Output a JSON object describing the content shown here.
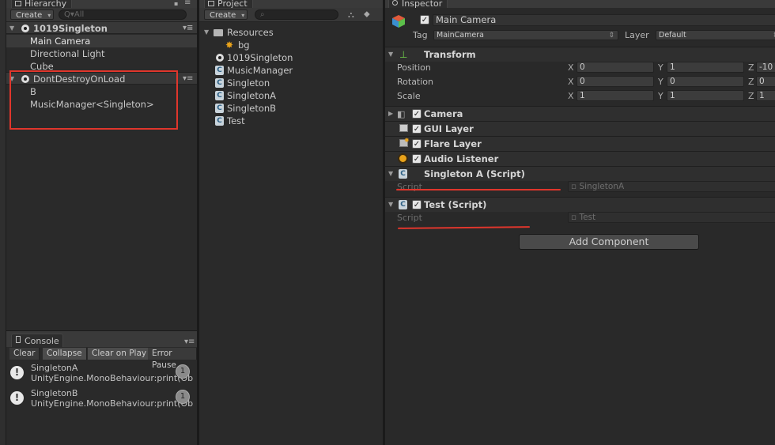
{
  "hierarchy": {
    "tab_label": "Hierarchy",
    "create_label": "Create",
    "search_placeholder": "Q▾All",
    "scenes": [
      {
        "name": "1019Singleton",
        "items": [
          "Main Camera",
          "Directional Light",
          "Cube"
        ]
      },
      {
        "name": "DontDestroyOnLoad",
        "items": [
          "B",
          "MusicManager<Singleton>"
        ]
      }
    ]
  },
  "project": {
    "tab_label": "Project",
    "create_label": "Create",
    "items": [
      {
        "name": "Resources",
        "icon": "folder-icon"
      },
      {
        "name": "bg",
        "icon": "image-icon"
      },
      {
        "name": "1019Singleton",
        "icon": "unity-scene-icon"
      },
      {
        "name": "MusicManager",
        "icon": "script-icon"
      },
      {
        "name": "Singleton",
        "icon": "script-icon"
      },
      {
        "name": "SingletonA",
        "icon": "script-icon"
      },
      {
        "name": "SingletonB",
        "icon": "script-icon"
      },
      {
        "name": "Test",
        "icon": "script-icon"
      }
    ]
  },
  "console": {
    "tab_label": "Console",
    "buttons": [
      "Clear",
      "Collapse",
      "Clear on Play",
      "Error Pause"
    ],
    "entries": [
      {
        "title": "SingletonA",
        "detail": "UnityEngine.MonoBehaviour:print(Ob",
        "count": "1"
      },
      {
        "title": "SingletonB",
        "detail": "UnityEngine.MonoBehaviour:print(Ob",
        "count": "1"
      }
    ]
  },
  "inspector": {
    "tab_label": "Inspector",
    "object_name": "Main Camera",
    "tag_label": "Tag",
    "tag_value": "MainCamera",
    "layer_label": "Layer",
    "layer_value": "Default",
    "transform": {
      "title": "Transform",
      "rows": [
        {
          "label": "Position",
          "x": "0",
          "y": "1",
          "z": "-10"
        },
        {
          "label": "Rotation",
          "x": "0",
          "y": "0",
          "z": "0"
        },
        {
          "label": "Scale",
          "x": "1",
          "y": "1",
          "z": "1"
        }
      ]
    },
    "components": [
      "Camera",
      "GUI Layer",
      "Flare Layer",
      "Audio Listener"
    ],
    "singleton_a": {
      "title": "Singleton A (Script)",
      "script_label": "Script",
      "script_value": "SingletonA"
    },
    "test_script": {
      "title": "Test (Script)",
      "script_label": "Script",
      "script_value": "Test"
    },
    "add_component_label": "Add Component"
  },
  "colors": {
    "highlight": "#e0362c",
    "panel": "#2a2a2a",
    "background": "#1a1a1a"
  }
}
